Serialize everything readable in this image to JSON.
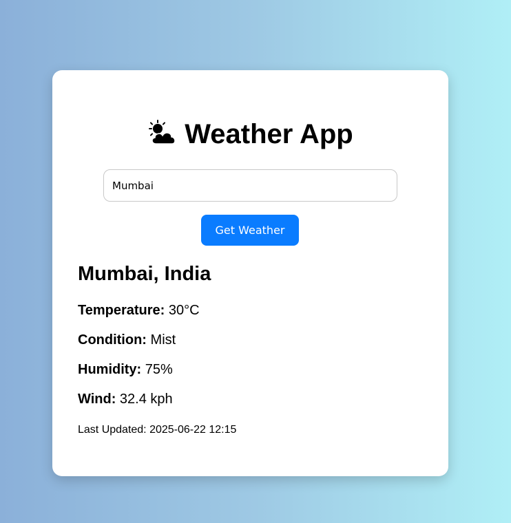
{
  "app": {
    "title": "Weather App",
    "title_icon": "sun-behind-cloud-icon"
  },
  "search": {
    "value": "Mumbai"
  },
  "button": {
    "label": "Get Weather",
    "color": "#0a7cff"
  },
  "weather": {
    "location": "Mumbai, India",
    "temperature_label": "Temperature:",
    "temperature_value": "30°C",
    "condition_label": "Condition:",
    "condition_value": "Mist",
    "humidity_label": "Humidity:",
    "humidity_value": "75%",
    "wind_label": "Wind:",
    "wind_value": "32.4 kph",
    "last_updated": "Last Updated: 2025-06-22 12:15"
  }
}
